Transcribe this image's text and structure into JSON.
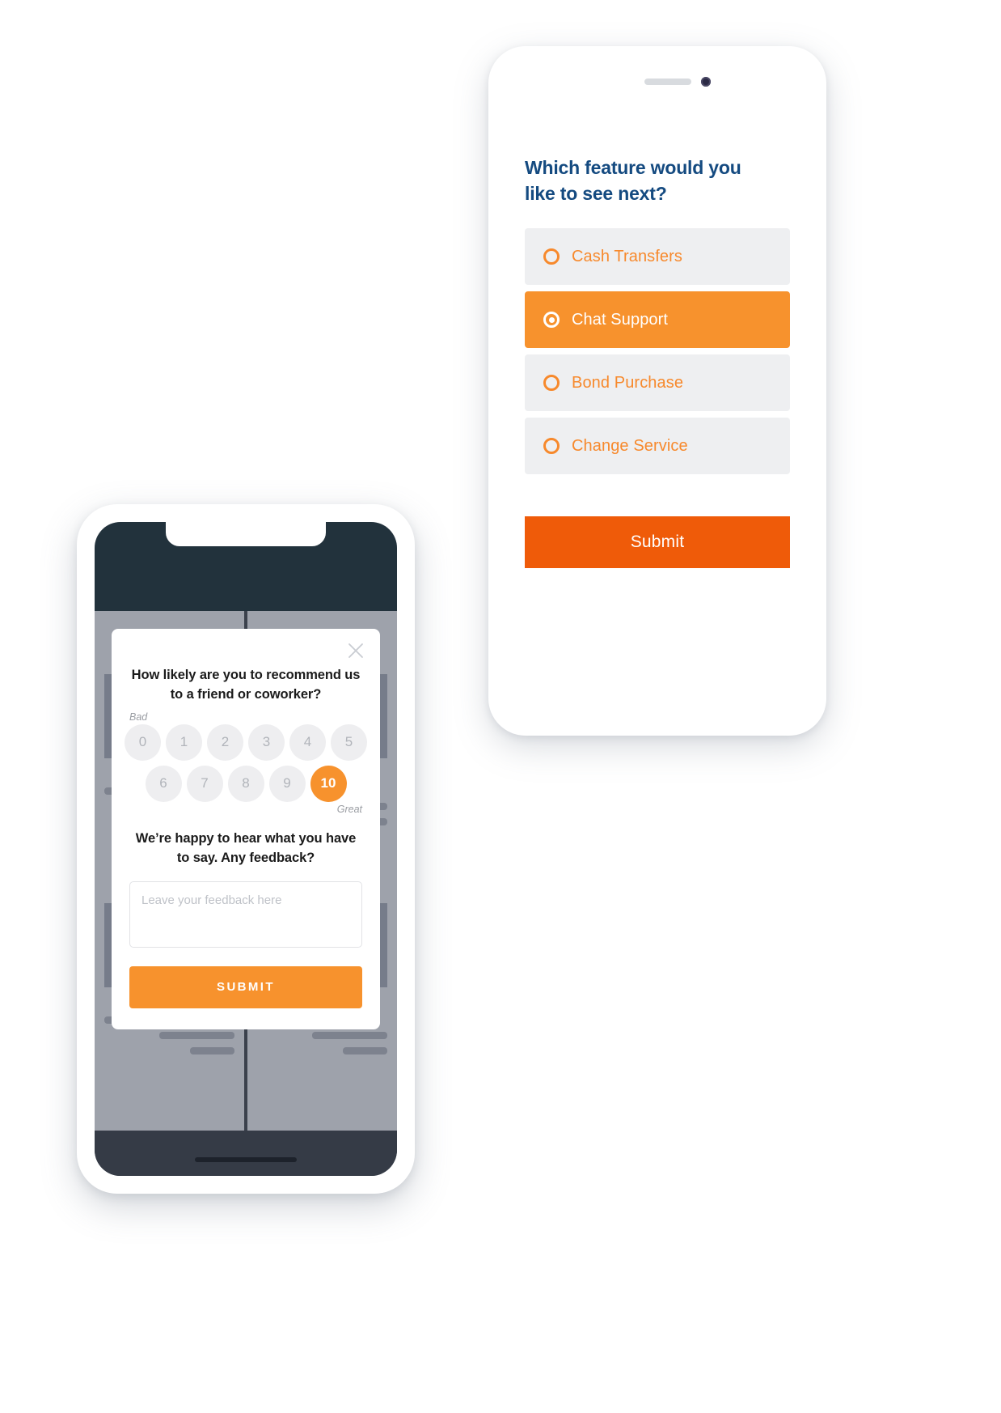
{
  "survey_phone": {
    "device": "white-smartphone",
    "title": "Which feature would you like to see next?",
    "title_color": "#144a80",
    "accent_color": "#f7892c",
    "option_bg": "#eeeff1",
    "selected_bg": "#f7922d",
    "options": [
      {
        "label": "Cash Transfers",
        "selected": false
      },
      {
        "label": "Chat Support",
        "selected": true
      },
      {
        "label": "Bond Purchase",
        "selected": false
      },
      {
        "label": "Change Service",
        "selected": false
      }
    ],
    "submit_label": "Submit",
    "submit_color": "#ef5b09"
  },
  "nps_phone": {
    "device": "dark-smartphone",
    "screen_color": "#22323c",
    "modal": {
      "close_icon": "close-x-icon",
      "question": "How likely are you to recommend us to a friend or coworker?",
      "scale_min_label": "Bad",
      "scale_max_label": "Great",
      "scale_row_1": [
        "0",
        "1",
        "2",
        "3",
        "4",
        "5"
      ],
      "scale_row_2": [
        "6",
        "7",
        "8",
        "9",
        "10"
      ],
      "selected_value": "10",
      "selected_color": "#f7922d",
      "feedback_prompt": "We’re happy to hear what you have to say. Any feedback?",
      "feedback_value": "",
      "feedback_placeholder": "Leave your feedback here",
      "submit_label": "SUBMIT",
      "submit_color": "#f7922d"
    }
  }
}
